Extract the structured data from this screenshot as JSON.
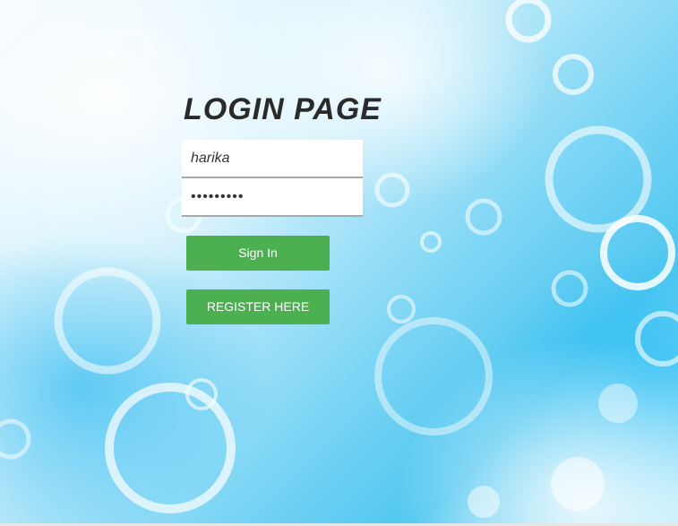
{
  "login": {
    "title": "LOGIN PAGE",
    "username_value": "harika",
    "password_value": "•••••••••",
    "signin_label": "Sign In",
    "register_label": "REGISTER HERE"
  },
  "colors": {
    "button_bg": "#4caf50",
    "title_color": "#2a2a2a",
    "background_accent": "#4ec6f0"
  }
}
